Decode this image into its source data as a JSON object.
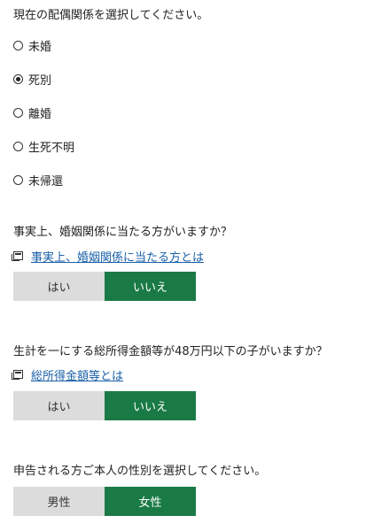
{
  "marital": {
    "question": "現在の配偶関係を選択してください。",
    "options": [
      {
        "label": "未婚",
        "selected": false
      },
      {
        "label": "死別",
        "selected": true
      },
      {
        "label": "離婚",
        "selected": false
      },
      {
        "label": "生死不明",
        "selected": false
      },
      {
        "label": "未帰還",
        "selected": false
      }
    ]
  },
  "de_facto": {
    "question": "事実上、婚姻関係に当たる方がいますか？",
    "help_link": "事実上、婚姻関係に当たる方とは",
    "yes_label": "はい",
    "no_label": "いいえ",
    "selected": "no"
  },
  "child_income": {
    "question": "生計を一にする総所得金額等が48万円以下の子がいますか？",
    "help_link": "総所得金額等とは",
    "yes_label": "はい",
    "no_label": "いいえ",
    "selected": "no"
  },
  "gender": {
    "question": "申告される方ご本人の性別を選択してください。",
    "male_label": "男性",
    "female_label": "女性",
    "selected": "female"
  },
  "colors": {
    "selected_button": "#1a7a45",
    "unselected_button": "#dcdcdc",
    "link": "#1a5fa8"
  }
}
